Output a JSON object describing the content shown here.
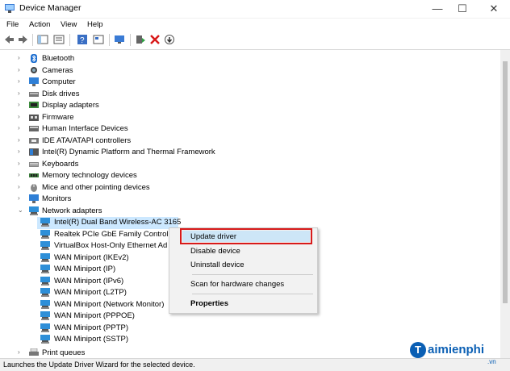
{
  "window": {
    "title": "Device Manager",
    "minimize": "—",
    "maximize": "☐",
    "close": "✕"
  },
  "menu": [
    "File",
    "Action",
    "View",
    "Help"
  ],
  "tree": {
    "categories": [
      {
        "label": "Bluetooth",
        "icon": "bluetooth-icon"
      },
      {
        "label": "Cameras",
        "icon": "camera-icon"
      },
      {
        "label": "Computer",
        "icon": "computer-icon"
      },
      {
        "label": "Disk drives",
        "icon": "disk-drive-icon"
      },
      {
        "label": "Display adapters",
        "icon": "display-adapter-icon"
      },
      {
        "label": "Firmware",
        "icon": "firmware-icon"
      },
      {
        "label": "Human Interface Devices",
        "icon": "hid-icon"
      },
      {
        "label": "IDE ATA/ATAPI controllers",
        "icon": "ide-controller-icon"
      },
      {
        "label": "Intel(R) Dynamic Platform and Thermal Framework",
        "icon": "thermal-framework-icon"
      },
      {
        "label": "Keyboards",
        "icon": "keyboard-icon"
      },
      {
        "label": "Memory technology devices",
        "icon": "memory-icon"
      },
      {
        "label": "Mice and other pointing devices",
        "icon": "mouse-icon"
      },
      {
        "label": "Monitors",
        "icon": "monitor-icon"
      },
      {
        "label": "Network adapters",
        "icon": "network-adapter-icon"
      }
    ],
    "network_children": [
      "Intel(R) Dual Band Wireless-AC 3165",
      "Realtek PCIe GbE Family Controlle",
      "VirtualBox Host-Only Ethernet Ad",
      "WAN Miniport (IKEv2)",
      "WAN Miniport (IP)",
      "WAN Miniport (IPv6)",
      "WAN Miniport (L2TP)",
      "WAN Miniport (Network Monitor)",
      "WAN Miniport (PPPOE)",
      "WAN Miniport (PPTP)",
      "WAN Miniport (SSTP)"
    ],
    "after": {
      "label": "Print queues",
      "icon": "printer-icon"
    }
  },
  "context_menu": {
    "update_driver": "Update driver",
    "disable_device": "Disable device",
    "uninstall_device": "Uninstall device",
    "scan": "Scan for hardware changes",
    "properties": "Properties"
  },
  "status": "Launches the Update Driver Wizard for the selected device.",
  "watermark": {
    "logo": "T",
    "text": "aimienphi",
    "sub": ".vn"
  },
  "colors": {
    "selection": "#cce8ff",
    "highlight_border": "#d81a1a",
    "network_icon": "#2e8fd8"
  }
}
